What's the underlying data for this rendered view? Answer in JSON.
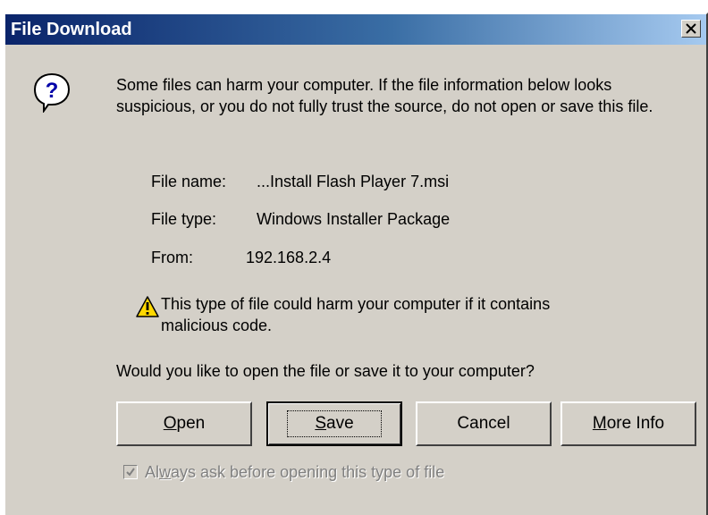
{
  "window": {
    "title": "File Download",
    "close_label": "X"
  },
  "message": {
    "intro": "Some files can harm your computer. If the file information below looks suspicious, or you do not fully trust the source, do not open or save this file."
  },
  "file_info": {
    "name_label": "File name:",
    "name_value": "...Install Flash Player 7.msi",
    "type_label": "File type:",
    "type_value": "Windows Installer Package",
    "from_label": "From:",
    "from_value": "192.168.2.4"
  },
  "warning": {
    "line1": "This type of file could harm your computer if it contains",
    "line2": "malicious code."
  },
  "prompt": "Would you like to open the file or save it to your computer?",
  "buttons": {
    "open": {
      "mnemonic": "O",
      "rest": "pen"
    },
    "save": {
      "mnemonic": "S",
      "rest": "ave"
    },
    "cancel": {
      "label": "Cancel"
    },
    "more_info": {
      "mnemonic": "M",
      "rest": "ore Info"
    }
  },
  "checkbox": {
    "checked": true,
    "disabled": true,
    "label_pre": "Al",
    "label_mnemonic": "w",
    "label_rest": "ays ask before opening this type of file"
  },
  "icons": {
    "question": "question-balloon-icon",
    "warning": "warning-triangle-icon",
    "close": "close-x-icon",
    "check": "checkmark-icon"
  },
  "colors": {
    "dialog_bg": "#d4d0c8",
    "title_start": "#0a246a",
    "title_end": "#a6caf0",
    "warning_yellow": "#ffd800",
    "question_blue": "#0000a8",
    "disabled_text": "#808080"
  }
}
